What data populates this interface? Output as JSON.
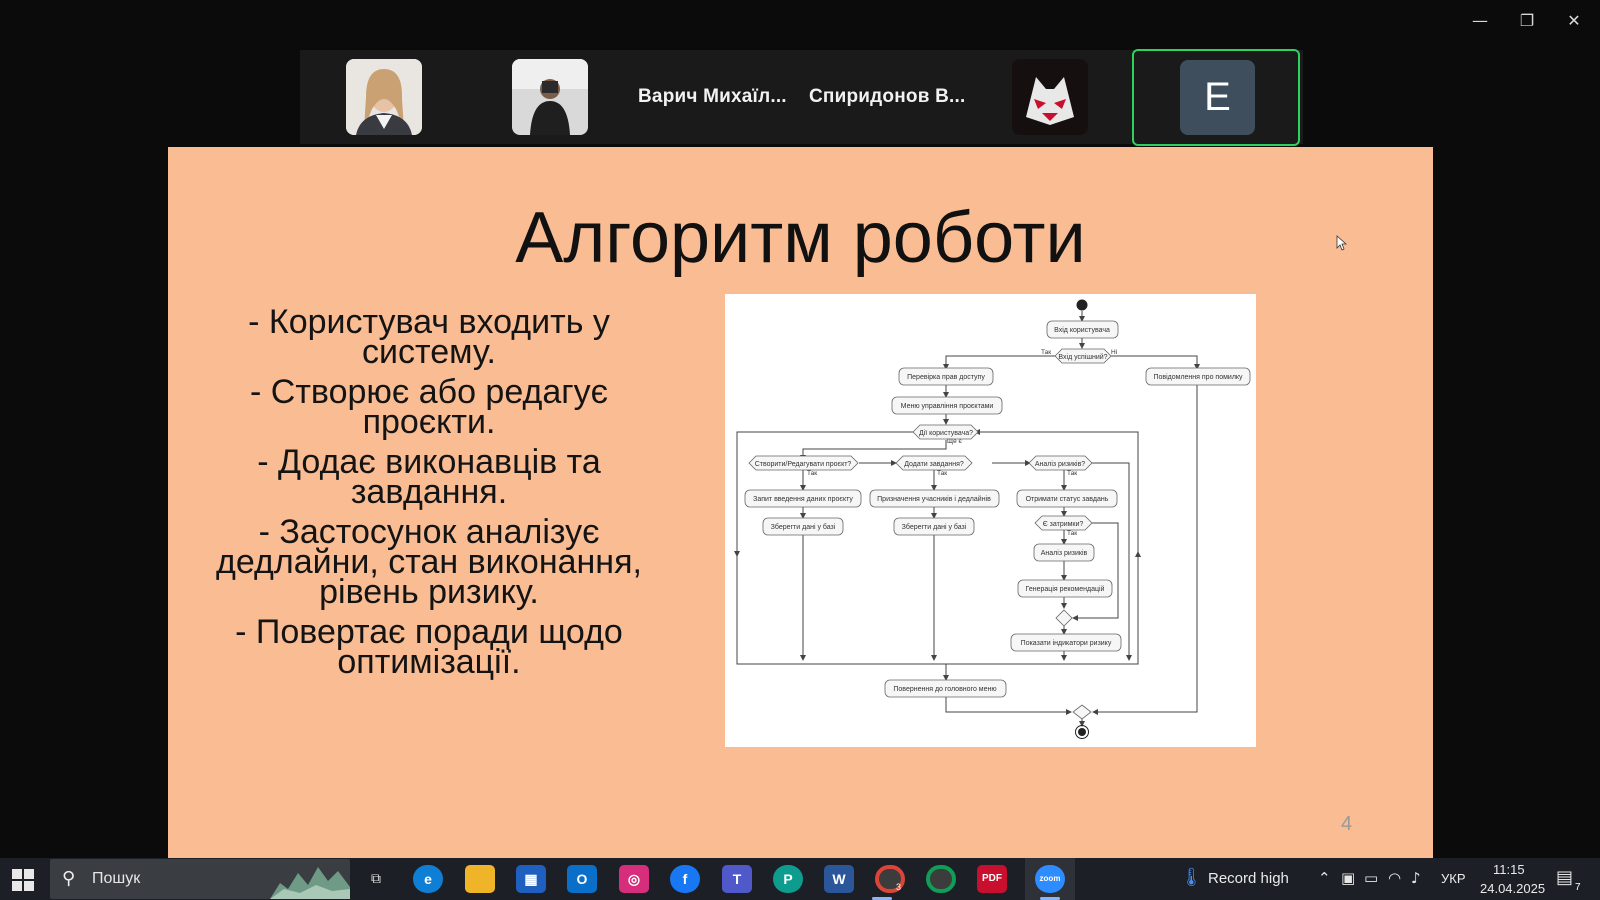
{
  "window": {
    "minimize": "—",
    "restore": "❐",
    "close": "✕"
  },
  "participants": {
    "name1": "Варич Михаїл...",
    "name2": "Спиридонов В...",
    "active_initial": "E"
  },
  "slide": {
    "title": "Алгоритм роботи",
    "bullets": [
      "- Користувач входить у систему.",
      "- Створює або редагує проєкти.",
      "- Додає виконавців та завдання.",
      "- Застосунок аналізує дедлайни,   стан виконання, рівень ризику.",
      "- Повертає поради щодо оптимізації."
    ],
    "page_number": "4",
    "diagram": {
      "login": "Вхід користувача",
      "login_ok": "Вхід успішний?",
      "yes": "Так",
      "no": "Ні",
      "check_rights": "Перевірка прав доступу",
      "error_msg": "Повідомлення про помилку",
      "menu": "Меню управління проєктами",
      "user_action": "Дії користувача?",
      "still": "Ще є",
      "create_edit": "Створити/Редагувати проєкт?",
      "add_tasks": "Додати завдання?",
      "risk_analysis_q": "Аналіз ризиків?",
      "yes1": "Так",
      "yes2": "Так",
      "yes3": "Так",
      "project_input": "Запит введення даних проєкту",
      "assign": "Призначення учасників і дедлайнів",
      "get_status": "Отримати статус завдань",
      "save1": "Зберегти дані у базі",
      "save2": "Зберегти дані у базі",
      "delays_q": "Є затримки?",
      "yes4": "Так",
      "risk_analysis": "Аналіз ризиків",
      "recommend": "Генерація рекомендацій",
      "show_indicators": "Показати індикатори ризику",
      "back_menu": "Повернення до головного меню"
    }
  },
  "taskbar": {
    "search_placeholder": "Пошук",
    "weather": "Record high",
    "language": "УКР",
    "time": "11:15",
    "date": "24.04.2025",
    "notifications_count": "7",
    "chrome_badge": "3"
  }
}
